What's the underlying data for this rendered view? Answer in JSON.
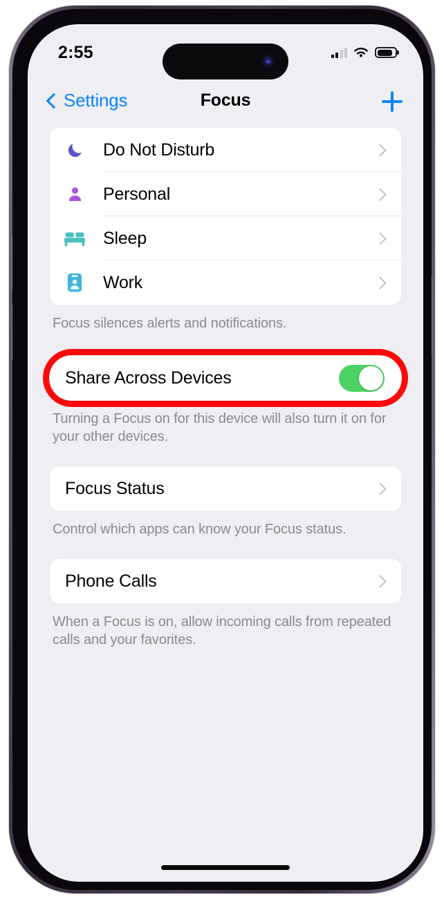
{
  "status_bar": {
    "time": "2:55",
    "cellular_icon": "signal-bars-icon",
    "cellular_bars_filled": 2,
    "cellular_bars_total": 4,
    "wifi_icon": "wifi-icon",
    "battery_icon": "battery-icon",
    "battery_level_percent": 75
  },
  "nav": {
    "back_label": "Settings",
    "back_icon": "chevron-left-icon",
    "title": "Focus",
    "add_icon": "plus-icon"
  },
  "focus_list": {
    "items": [
      {
        "label": "Do Not Disturb",
        "icon": "moon-icon",
        "icon_color": "#5755c8"
      },
      {
        "label": "Personal",
        "icon": "person-icon",
        "icon_color": "#a855d8"
      },
      {
        "label": "Sleep",
        "icon": "bed-icon",
        "icon_color": "#4cc0bc"
      },
      {
        "label": "Work",
        "icon": "id-badge-icon",
        "icon_color": "#3fb6d8"
      }
    ],
    "footer": "Focus silences alerts and notifications."
  },
  "share_section": {
    "label": "Share Across Devices",
    "toggle_state": "on",
    "toggle_color": "#4cd264",
    "highlight_color": "#fa0a0a",
    "footer": "Turning a Focus on for this device will also turn it on for your other devices."
  },
  "focus_status_section": {
    "label": "Focus Status",
    "chevron_icon": "chevron-right-icon",
    "footer": "Control which apps can know your Focus status."
  },
  "phone_calls_section": {
    "label": "Phone Calls",
    "chevron_icon": "chevron-right-icon",
    "footer": "When a Focus is on, allow incoming calls from repeated calls and your favorites."
  }
}
